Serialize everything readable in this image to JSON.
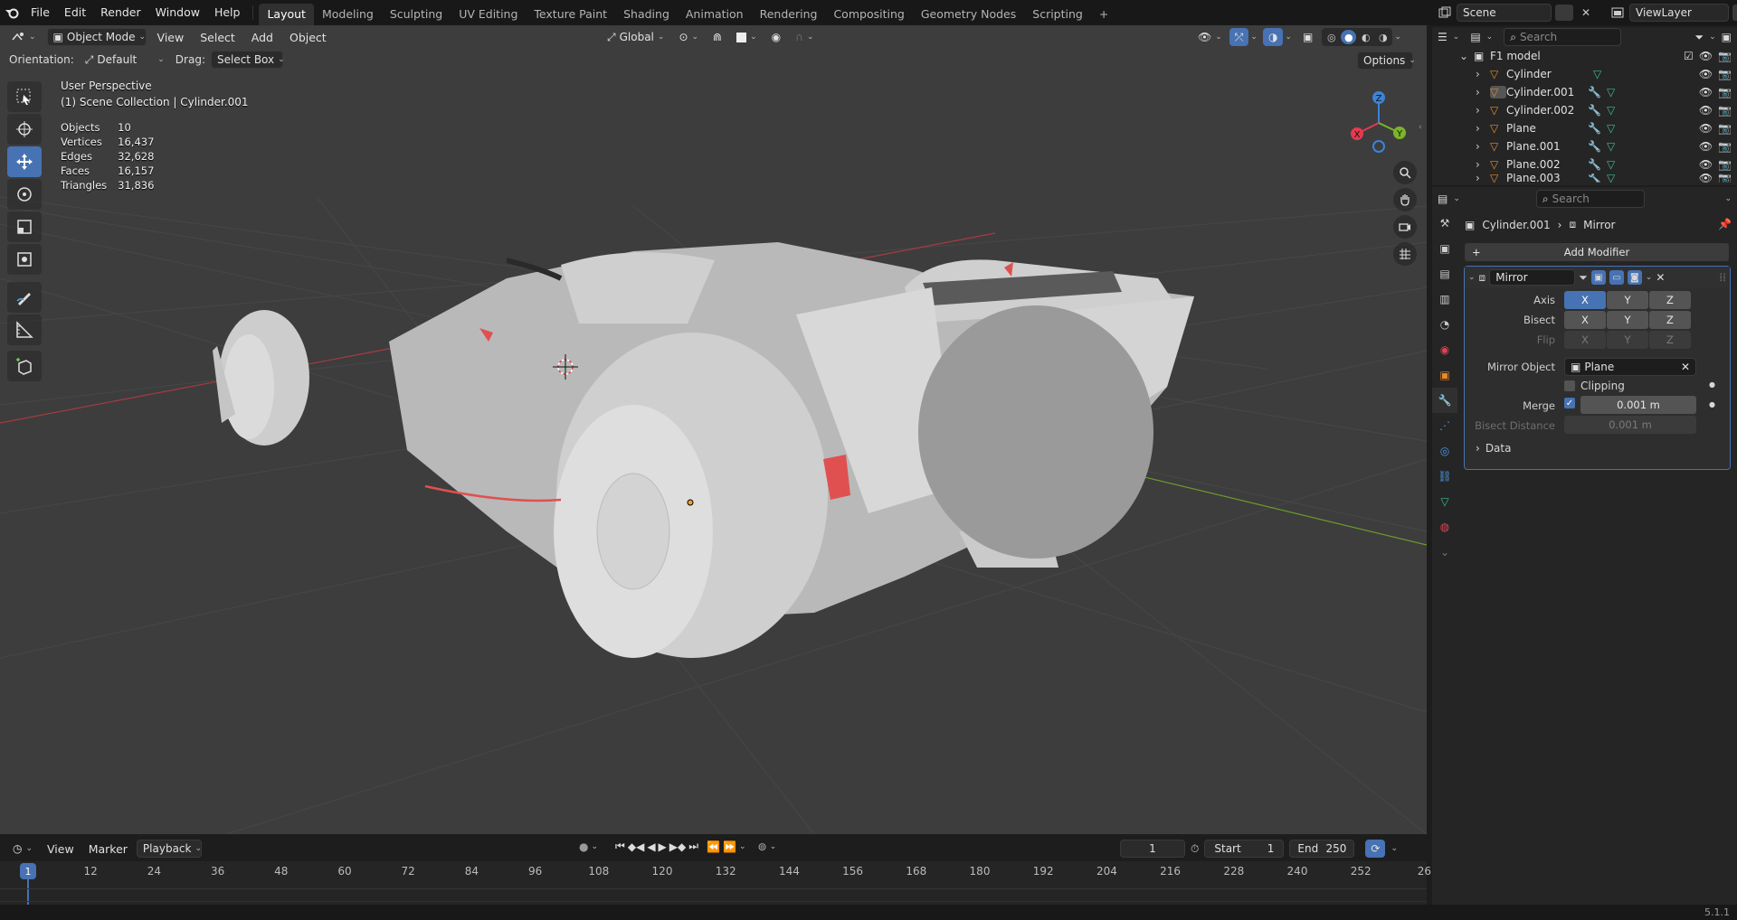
{
  "topbar": {
    "menus": [
      "File",
      "Edit",
      "Render",
      "Window",
      "Help"
    ],
    "workspaces": [
      "Layout",
      "Modeling",
      "Sculpting",
      "UV Editing",
      "Texture Paint",
      "Shading",
      "Animation",
      "Rendering",
      "Compositing",
      "Geometry Nodes",
      "Scripting"
    ],
    "active_workspace": "Layout",
    "add_tab": "+",
    "scene_label": "Scene",
    "viewlayer_label": "ViewLayer"
  },
  "viewport": {
    "mode": "Object Mode",
    "menus": [
      "View",
      "Select",
      "Add",
      "Object"
    ],
    "transform_orientation": "Global",
    "orientation_label": "Orientation:",
    "orientation_value": "Default",
    "drag_label": "Drag:",
    "drag_value": "Select Box",
    "options_label": "Options",
    "perspective": "User Perspective",
    "collection": "(1) Scene Collection | Cylinder.001",
    "stats": [
      {
        "label": "Objects",
        "value": "10"
      },
      {
        "label": "Vertices",
        "value": "16,437"
      },
      {
        "label": "Edges",
        "value": "32,628"
      },
      {
        "label": "Faces",
        "value": "16,157"
      },
      {
        "label": "Triangles",
        "value": "31,836"
      }
    ],
    "gizmo": {
      "x": "X",
      "y": "Y",
      "z": "Z"
    }
  },
  "timeline": {
    "menus": [
      "View",
      "Marker"
    ],
    "playback": "Playback",
    "current_frame": "1",
    "start_label": "Start",
    "start_value": "1",
    "end_label": "End",
    "end_value": "250",
    "ticks": [
      "12",
      "24",
      "36",
      "48",
      "60",
      "72",
      "84",
      "96",
      "108",
      "120",
      "132",
      "144",
      "156",
      "168",
      "180",
      "192",
      "204",
      "216",
      "228",
      "240",
      "252",
      "26"
    ],
    "playhead": "1"
  },
  "outliner": {
    "search_placeholder": "Search",
    "collection": "F1 model",
    "items": [
      "Cylinder",
      "Cylinder.001",
      "Cylinder.002",
      "Plane",
      "Plane.001",
      "Plane.002",
      "Plane.003"
    ]
  },
  "properties": {
    "search_placeholder": "Search",
    "breadcrumb_object": "Cylinder.001",
    "breadcrumb_modifier": "Mirror",
    "add_modifier": "Add Modifier",
    "modifier_name": "Mirror",
    "axis_label": "Axis",
    "bisect_label": "Bisect",
    "flip_label": "Flip",
    "x": "X",
    "y": "Y",
    "z": "Z",
    "mirror_object_label": "Mirror Object",
    "mirror_object_value": "Plane",
    "clipping_label": "Clipping",
    "merge_label": "Merge",
    "merge_value": "0.001 m",
    "bisect_distance_label": "Bisect Distance",
    "bisect_distance_value": "0.001 m",
    "data_label": "Data"
  },
  "status": {
    "version": "5.1.1"
  },
  "colors": {
    "accent": "#4772b3",
    "viewport_bg": "#3d3d3d",
    "axis_x": "#e23b4e",
    "axis_y": "#7ab528",
    "axis_z": "#3c83d8"
  }
}
